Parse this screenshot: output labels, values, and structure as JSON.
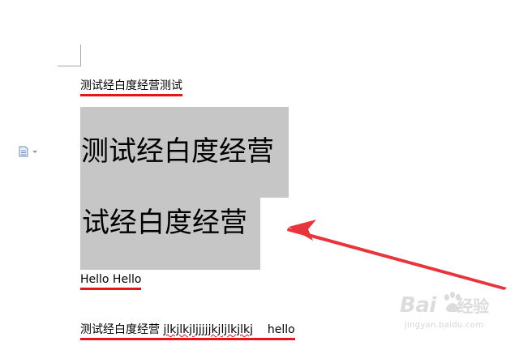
{
  "document": {
    "line1": "测试经白度经营测试",
    "block1": "测试经白度经营",
    "block2": "试经白度经营",
    "hello_line": "Hello Hello",
    "last_line_cn": "测试经白度经营",
    "last_line_misspelled": "jlkjlkjljjjjjkjljlkjlkj",
    "last_line_hello": "hello"
  },
  "watermark": {
    "brand": "Bai",
    "brand_suffix": "经验",
    "url": "jingyan.baidu.com"
  },
  "colors": {
    "highlight": "#c6c6c6",
    "underline": "#e8141a",
    "arrow": "#e8343a"
  },
  "icons": {
    "paragraph": "document-paragraph-icon",
    "arrow": "red-arrow-annotation"
  }
}
